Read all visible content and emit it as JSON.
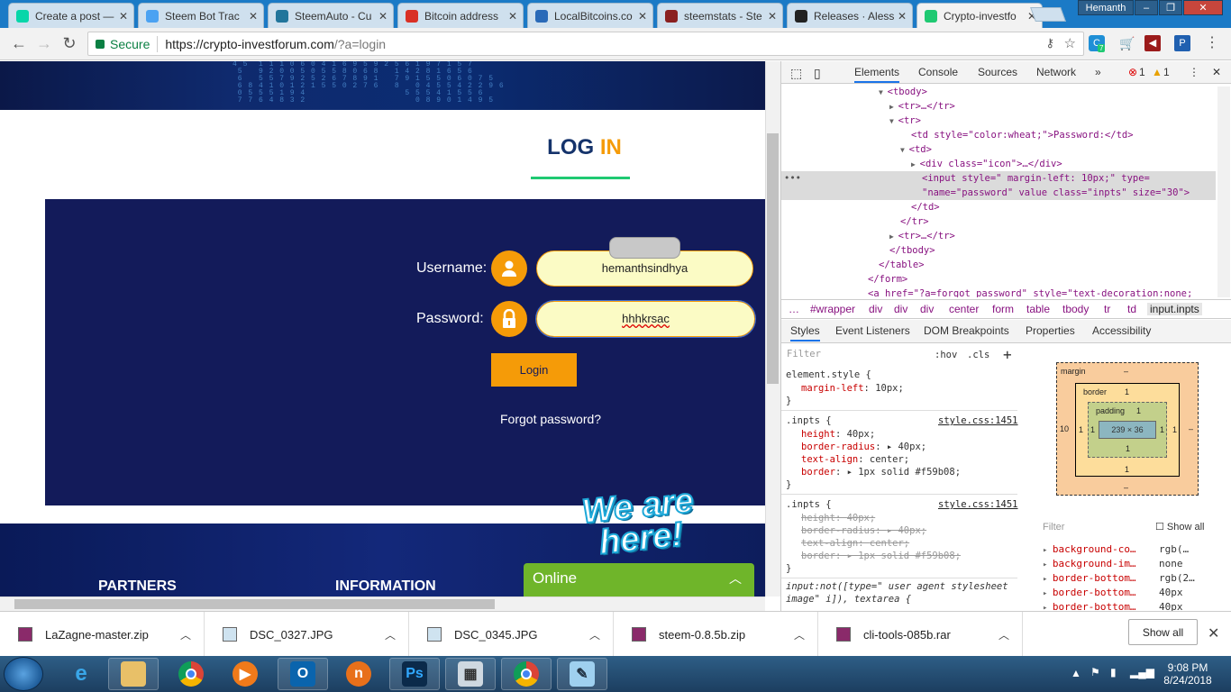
{
  "browser": {
    "tabs": [
      {
        "title": "Create a post —",
        "favicon": "steemit-icon",
        "color": "#06d6a9"
      },
      {
        "title": "Steem Bot Trac",
        "favicon": "steem-icon",
        "color": "#4ba2f2"
      },
      {
        "title": "SteemAuto - Cu",
        "favicon": "wordpress-icon",
        "color": "#21759b"
      },
      {
        "title": "Bitcoin address",
        "favicon": "gmail-icon",
        "color": "#d93025"
      },
      {
        "title": "LocalBitcoins.co",
        "favicon": "localbitcoins-icon",
        "color": "#2a6ab8"
      },
      {
        "title": "steemstats - Ste",
        "favicon": "steemstats-icon",
        "color": "#8a2020"
      },
      {
        "title": "Releases · Aless",
        "favicon": "github-icon",
        "color": "#222222"
      },
      {
        "title": "Crypto-investfo",
        "favicon": "crypto-icon",
        "color": "#1fc972"
      }
    ],
    "profile_name": "Hemanth",
    "secure_label": "Secure",
    "url_host": "https://crypto-investforum.com",
    "url_path": "/?a=login",
    "ext_badge": "7"
  },
  "page": {
    "banner_digits": "4 5  1 1 1 0 6 0 4 1 6 9 5 9 2 5 6 1 9 7 1 5 7\n 5   9 2 0 0 5 0 5 5 8 0 6 8   1 4 2 8 1 6 5 6\n 6   5 5 7 9 2 5 2 6 7 8 9 1   7 9 1 5 5 0 6 0 7 5\n 6 8 4 1 0 1 2 1 5 5 0 2 7 6   8   0 4 5 5 4 2 2 9 6\n 0 5 5 5 1 9 4                   5 5 5 4 1 5 5 6\n 7 7 6 4 8 3 2                     0 8 9 0 1 4 9 5",
    "title_part1": "LOG ",
    "title_part2": "IN",
    "username_label": "Username:",
    "username_value": "hemanthsindhya",
    "password_label": "Password:",
    "password_value": "hhhkrsac",
    "login_button": "Login",
    "forgot_link": "Forgot password?",
    "footer_partners": "PARTNERS",
    "footer_information": "INFORMATION",
    "chat_badge": "We are here!",
    "chat_online": "Online"
  },
  "devtools": {
    "tabs": [
      "Elements",
      "Console",
      "Sources",
      "Network"
    ],
    "error_count": "1",
    "warning_count": "1",
    "dom_lines": [
      {
        "indent": 9,
        "arrow": "▼",
        "text": "<tbody>"
      },
      {
        "indent": 10,
        "arrow": "▶",
        "text": "<tr>…</tr>"
      },
      {
        "indent": 10,
        "arrow": "▼",
        "text": "<tr>"
      },
      {
        "indent": 11,
        "arrow": "",
        "text": "<td style=\"color:wheat;\">Password:</td>"
      },
      {
        "indent": 11,
        "arrow": "▼",
        "text": "<td>"
      },
      {
        "indent": 12,
        "arrow": "▶",
        "text": "<div class=\"icon\">…</div>"
      },
      {
        "indent": 12,
        "arrow": "",
        "text": "<input style=\"    margin-left: 10px;\" type="
      },
      {
        "indent": 12,
        "arrow": "",
        "text": "\"name=\"password\" value class=\"inpts\" size=\"30\">"
      },
      {
        "indent": 11,
        "arrow": "",
        "text": "</td>"
      },
      {
        "indent": 10,
        "arrow": "",
        "text": "</tr>"
      },
      {
        "indent": 10,
        "arrow": "▶",
        "text": "<tr>…</tr>"
      },
      {
        "indent": 9,
        "arrow": "",
        "text": "</tbody>"
      },
      {
        "indent": 8,
        "arrow": "",
        "text": "</table>"
      },
      {
        "indent": 7,
        "arrow": "",
        "text": "</form>"
      },
      {
        "indent": 7,
        "arrow": "",
        "text": "<a href=\"?a=forgot_password\" style=\"text-decoration:none;"
      }
    ],
    "breadcrumbs": [
      "…",
      "#wrapper",
      "div",
      "div",
      "div",
      "center",
      "form",
      "table",
      "tbody",
      "tr",
      "td",
      "input.inpts"
    ],
    "subtabs": [
      "Styles",
      "Event Listeners",
      "DOM Breakpoints",
      "Properties",
      "Accessibility"
    ],
    "filter_placeholder": "Filter",
    "hov": ":hov",
    "cls": ".cls",
    "rules": [
      {
        "selector": "element.style {",
        "source": "",
        "props": [
          {
            "name": "margin-left",
            "value": "10px;",
            "struck": false
          }
        ]
      },
      {
        "selector": ".inpts {",
        "source": "style.css:1451",
        "props": [
          {
            "name": "height",
            "value": "40px;",
            "struck": false
          },
          {
            "name": "border-radius",
            "value": "▸ 40px;",
            "struck": false
          },
          {
            "name": "text-align",
            "value": "center;",
            "struck": false
          },
          {
            "name": "border",
            "value": "▸ 1px solid #f59b08;",
            "struck": false
          }
        ]
      },
      {
        "selector": ".inpts {",
        "source": "style.css:1451",
        "props": [
          {
            "name": "height",
            "value": "40px;",
            "struck": true
          },
          {
            "name": "border-radius",
            "value": "▸ 40px;",
            "struck": true
          },
          {
            "name": "text-align",
            "value": "center;",
            "struck": true
          },
          {
            "name": "border",
            "value": "▸ 1px solid #f59b08;",
            "struck": true
          }
        ]
      }
    ],
    "ua_rule": "input:not([type=\"  user agent stylesheet",
    "ua_rule2": "image\" i]), textarea {",
    "boxmodel": {
      "margin": "margin",
      "margin_top": "–",
      "margin_bottom": "–",
      "margin_left": "10",
      "margin_right": "–",
      "border": "border",
      "border_val": "1",
      "padding": "padding",
      "padding_val": "1",
      "content": "239 × 36"
    },
    "computed_filter": "Filter",
    "show_all": "Show all",
    "computed": [
      {
        "name": "background-co…",
        "value": "rgb(…"
      },
      {
        "name": "background-im…",
        "value": "none"
      },
      {
        "name": "border-bottom…",
        "value": "rgb(2…"
      },
      {
        "name": "border-bottom…",
        "value": "40px"
      },
      {
        "name": "border-bottom…",
        "value": "40px"
      }
    ]
  },
  "downloads": {
    "items": [
      "LaZagne-master.zip",
      "DSC_0327.JPG",
      "DSC_0345.JPG",
      "steem-0.8.5b.zip",
      "cli-tools-085b.rar"
    ],
    "show_all": "Show all"
  },
  "taskbar": {
    "time": "9:08 PM",
    "date": "8/24/2018"
  }
}
